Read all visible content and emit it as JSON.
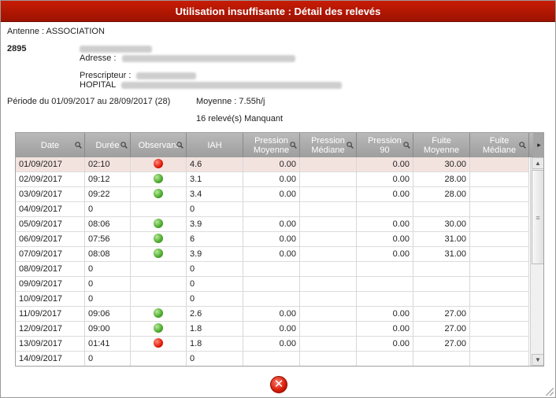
{
  "title": "Utilisation insuffisante : Détail des relevés",
  "patient": {
    "antenne": "Antenne : ASSOCIATION",
    "id": "2895",
    "adresse_label": "Adresse :",
    "prescripteur_label": "Prescripteur :",
    "hopital_label": "HOPITAL"
  },
  "summary": {
    "periode": "Période du 01/09/2017 au 28/09/2017 (28)",
    "moyenne": "Moyenne : 7.55h/j",
    "manquant": "16 relevé(s) Manquant"
  },
  "columns": [
    "Date",
    "Durée",
    "Observant",
    "IAH",
    "Pression Moyenne",
    "Pression Médiane",
    "Pression 90",
    "Fuite Moyenne",
    "Fuite Médiane"
  ],
  "rows": [
    {
      "date": "01/09/2017",
      "duree": "02:10",
      "obs": "red",
      "iah": "4.6",
      "pmoy": "0.00",
      "pmed": "",
      "p90": "0.00",
      "fmoy": "30.00",
      "fmed": ""
    },
    {
      "date": "02/09/2017",
      "duree": "09:12",
      "obs": "green",
      "iah": "3.1",
      "pmoy": "0.00",
      "pmed": "",
      "p90": "0.00",
      "fmoy": "28.00",
      "fmed": ""
    },
    {
      "date": "03/09/2017",
      "duree": "09:22",
      "obs": "green",
      "iah": "3.4",
      "pmoy": "0.00",
      "pmed": "",
      "p90": "0.00",
      "fmoy": "28.00",
      "fmed": ""
    },
    {
      "date": "04/09/2017",
      "duree": "0",
      "obs": "",
      "iah": "0",
      "pmoy": "",
      "pmed": "",
      "p90": "",
      "fmoy": "",
      "fmed": ""
    },
    {
      "date": "05/09/2017",
      "duree": "08:06",
      "obs": "green",
      "iah": "3.9",
      "pmoy": "0.00",
      "pmed": "",
      "p90": "0.00",
      "fmoy": "30.00",
      "fmed": ""
    },
    {
      "date": "06/09/2017",
      "duree": "07:56",
      "obs": "green",
      "iah": "6",
      "pmoy": "0.00",
      "pmed": "",
      "p90": "0.00",
      "fmoy": "31.00",
      "fmed": ""
    },
    {
      "date": "07/09/2017",
      "duree": "08:08",
      "obs": "green",
      "iah": "3.9",
      "pmoy": "0.00",
      "pmed": "",
      "p90": "0.00",
      "fmoy": "31.00",
      "fmed": ""
    },
    {
      "date": "08/09/2017",
      "duree": "0",
      "obs": "",
      "iah": "0",
      "pmoy": "",
      "pmed": "",
      "p90": "",
      "fmoy": "",
      "fmed": ""
    },
    {
      "date": "09/09/2017",
      "duree": "0",
      "obs": "",
      "iah": "0",
      "pmoy": "",
      "pmed": "",
      "p90": "",
      "fmoy": "",
      "fmed": ""
    },
    {
      "date": "10/09/2017",
      "duree": "0",
      "obs": "",
      "iah": "0",
      "pmoy": "",
      "pmed": "",
      "p90": "",
      "fmoy": "",
      "fmed": ""
    },
    {
      "date": "11/09/2017",
      "duree": "09:06",
      "obs": "green",
      "iah": "2.6",
      "pmoy": "0.00",
      "pmed": "",
      "p90": "0.00",
      "fmoy": "27.00",
      "fmed": ""
    },
    {
      "date": "12/09/2017",
      "duree": "09:00",
      "obs": "green",
      "iah": "1.8",
      "pmoy": "0.00",
      "pmed": "",
      "p90": "0.00",
      "fmoy": "27.00",
      "fmed": ""
    },
    {
      "date": "13/09/2017",
      "duree": "01:41",
      "obs": "red",
      "iah": "1.8",
      "pmoy": "0.00",
      "pmed": "",
      "p90": "0.00",
      "fmoy": "27.00",
      "fmed": ""
    },
    {
      "date": "14/09/2017",
      "duree": "0",
      "obs": "",
      "iah": "0",
      "pmoy": "",
      "pmed": "",
      "p90": "",
      "fmoy": "",
      "fmed": ""
    }
  ],
  "selected_row": 0,
  "icons": {
    "search": "magnifier-icon",
    "observant_ok": "green-status-icon",
    "observant_ko": "red-status-icon",
    "close": "close-icon",
    "scroll_up": "chevron-up-icon",
    "scroll_down": "chevron-down-icon",
    "scroll_right": "chevron-right-icon"
  },
  "colors": {
    "titlebar": "#b31703",
    "header": "#ababab",
    "selected_row": "#f3e3df",
    "ok": "#4ba82d",
    "ko": "#e01a0a"
  }
}
